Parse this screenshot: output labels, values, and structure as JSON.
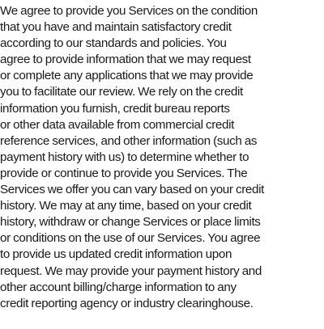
{
  "document": {
    "lines": [
      "We agree to provide you Services on the condition",
      "that you have and maintain satisfactory credit",
      "according to our standards and policies. You",
      "agree to provide information that we may request",
      "or complete any applications that we may provide",
      "you to facilitate our review. We rely on the credit",
      "information you furnish, credit bureau reports",
      "or other data available from commercial credit",
      "reference services, and other information (such as",
      "payment history with us) to determine whether to",
      "provide or continue to provide you Services. The",
      "Services we offer you can vary based on your credit",
      "history. We may at any time, based on your credit",
      "history, withdraw or change Services or place limits",
      "or conditions on the use of our Services. You agree",
      "to provide us updated credit information upon",
      "request. We may provide your payment history and",
      "other account billing/charge information to any",
      "credit reporting agency or industry clearinghouse."
    ]
  },
  "colors": {
    "text": "#1a1a1a",
    "background": "#ffffff"
  }
}
